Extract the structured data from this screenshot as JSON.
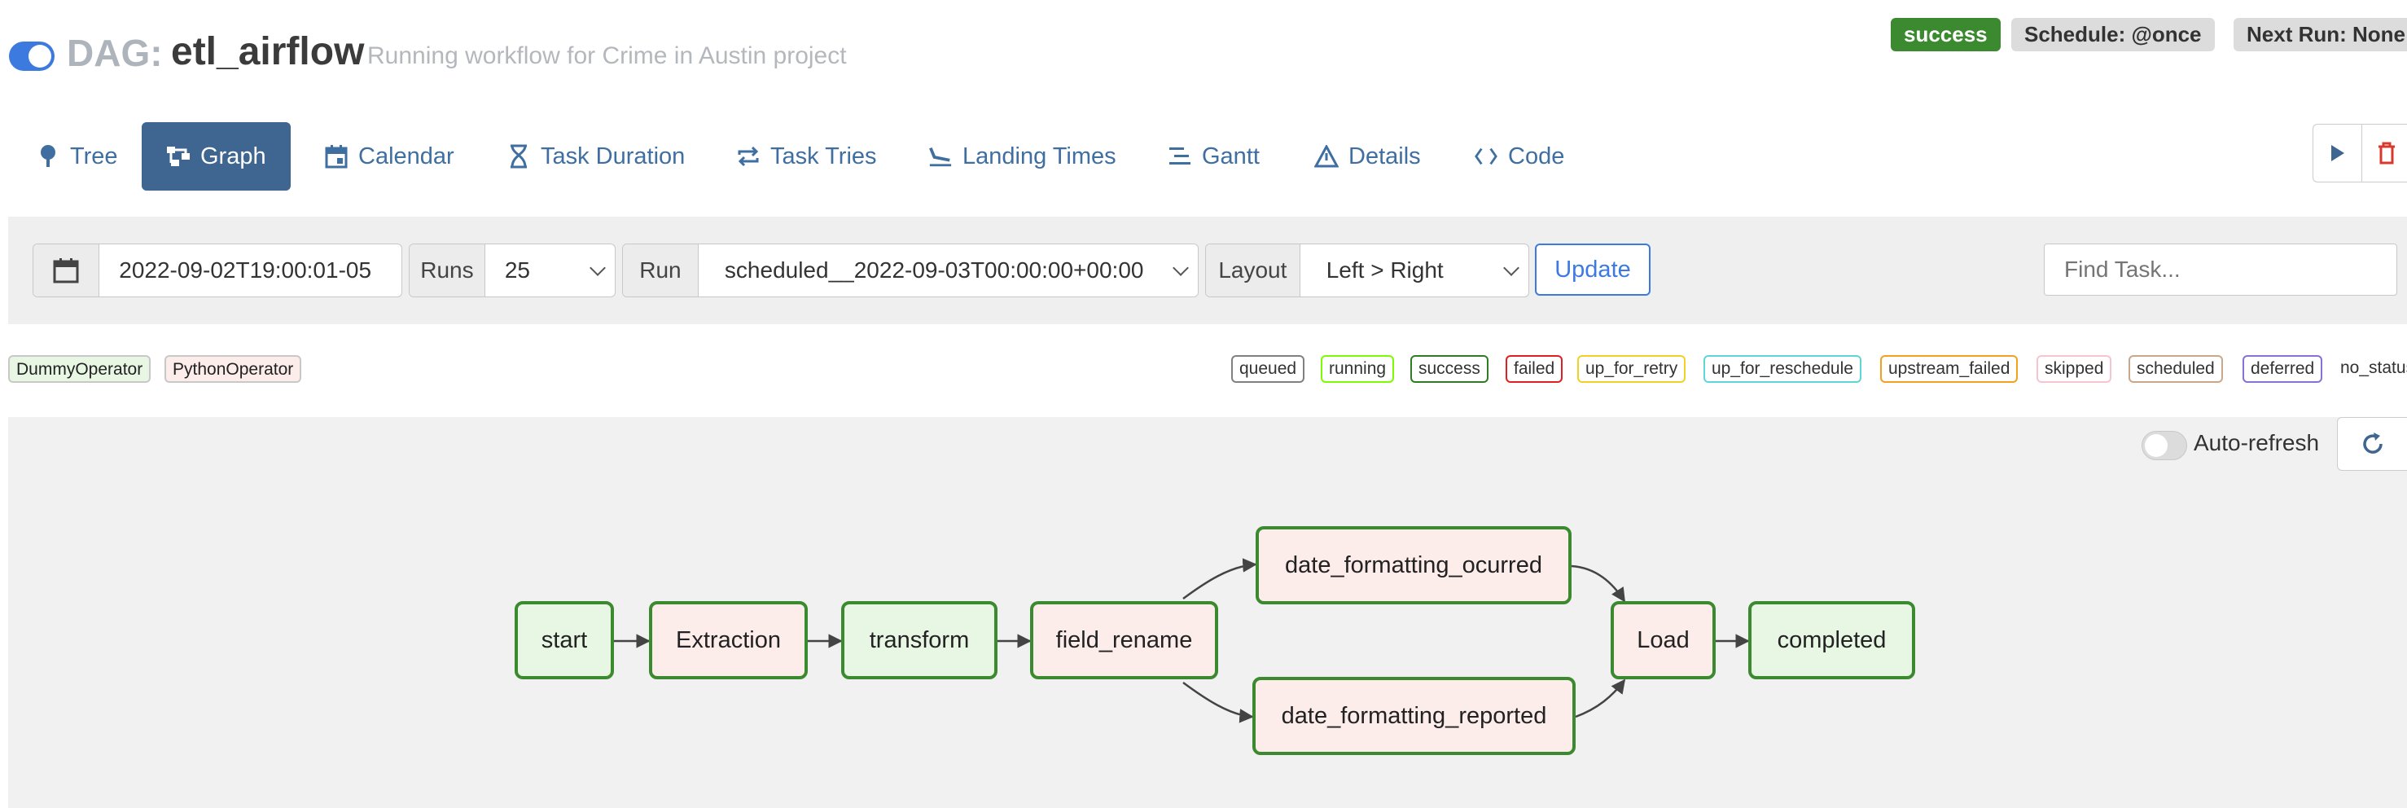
{
  "header": {
    "prefix": "DAG:",
    "dag_id": "etl_airflow",
    "description": "Running workflow for Crime in Austin project",
    "status_badge": "success",
    "schedule_badge": "Schedule: @once",
    "next_run_badge": "Next Run: None"
  },
  "tabs": [
    {
      "label": "Tree",
      "icon": "tree-icon"
    },
    {
      "label": "Graph",
      "icon": "graph-icon",
      "active": true
    },
    {
      "label": "Calendar",
      "icon": "calendar-icon"
    },
    {
      "label": "Task Duration",
      "icon": "hourglass-icon"
    },
    {
      "label": "Task Tries",
      "icon": "retry-icon"
    },
    {
      "label": "Landing Times",
      "icon": "plane-landing-icon"
    },
    {
      "label": "Gantt",
      "icon": "gantt-icon"
    },
    {
      "label": "Details",
      "icon": "warning-triangle-icon"
    },
    {
      "label": "Code",
      "icon": "code-icon"
    }
  ],
  "toolbar": {
    "base_date": "2022-09-02T19:00:01-05",
    "runs_label": "Runs",
    "runs_value": "25",
    "run_label": "Run",
    "run_value": "scheduled__2022-09-03T00:00:00+00:00",
    "layout_label": "Layout",
    "layout_value": "Left > Right",
    "update_label": "Update",
    "find_placeholder": "Find Task..."
  },
  "operators": [
    {
      "label": "DummyOperator",
      "color": "#e8f7e4"
    },
    {
      "label": "PythonOperator",
      "color": "#fcecea"
    }
  ],
  "states": [
    {
      "label": "queued",
      "color": "#808080"
    },
    {
      "label": "running",
      "color": "#7cfc00"
    },
    {
      "label": "success",
      "color": "#2e7d22"
    },
    {
      "label": "failed",
      "color": "#e02020"
    },
    {
      "label": "up_for_retry",
      "color": "#f2d024"
    },
    {
      "label": "up_for_reschedule",
      "color": "#5fd6d6"
    },
    {
      "label": "upstream_failed",
      "color": "#f5a021"
    },
    {
      "label": "skipped",
      "color": "#f8c4d0"
    },
    {
      "label": "scheduled",
      "color": "#c8a88a"
    },
    {
      "label": "deferred",
      "color": "#8a6fd6"
    }
  ],
  "no_status_label": "no_status",
  "graph": {
    "auto_refresh_label": "Auto-refresh",
    "nodes": {
      "start": "start",
      "extraction": "Extraction",
      "transform": "transform",
      "field_rename": "field_rename",
      "date_ocurred": "date_formatting_ocurred",
      "date_reported": "date_formatting_reported",
      "load": "Load",
      "completed": "completed"
    }
  },
  "colors": {
    "accent": "#3c7ae0",
    "active_tab": "#3f6591",
    "success_badge": "#3b8a2f",
    "node_border": "#3b8a2f"
  }
}
